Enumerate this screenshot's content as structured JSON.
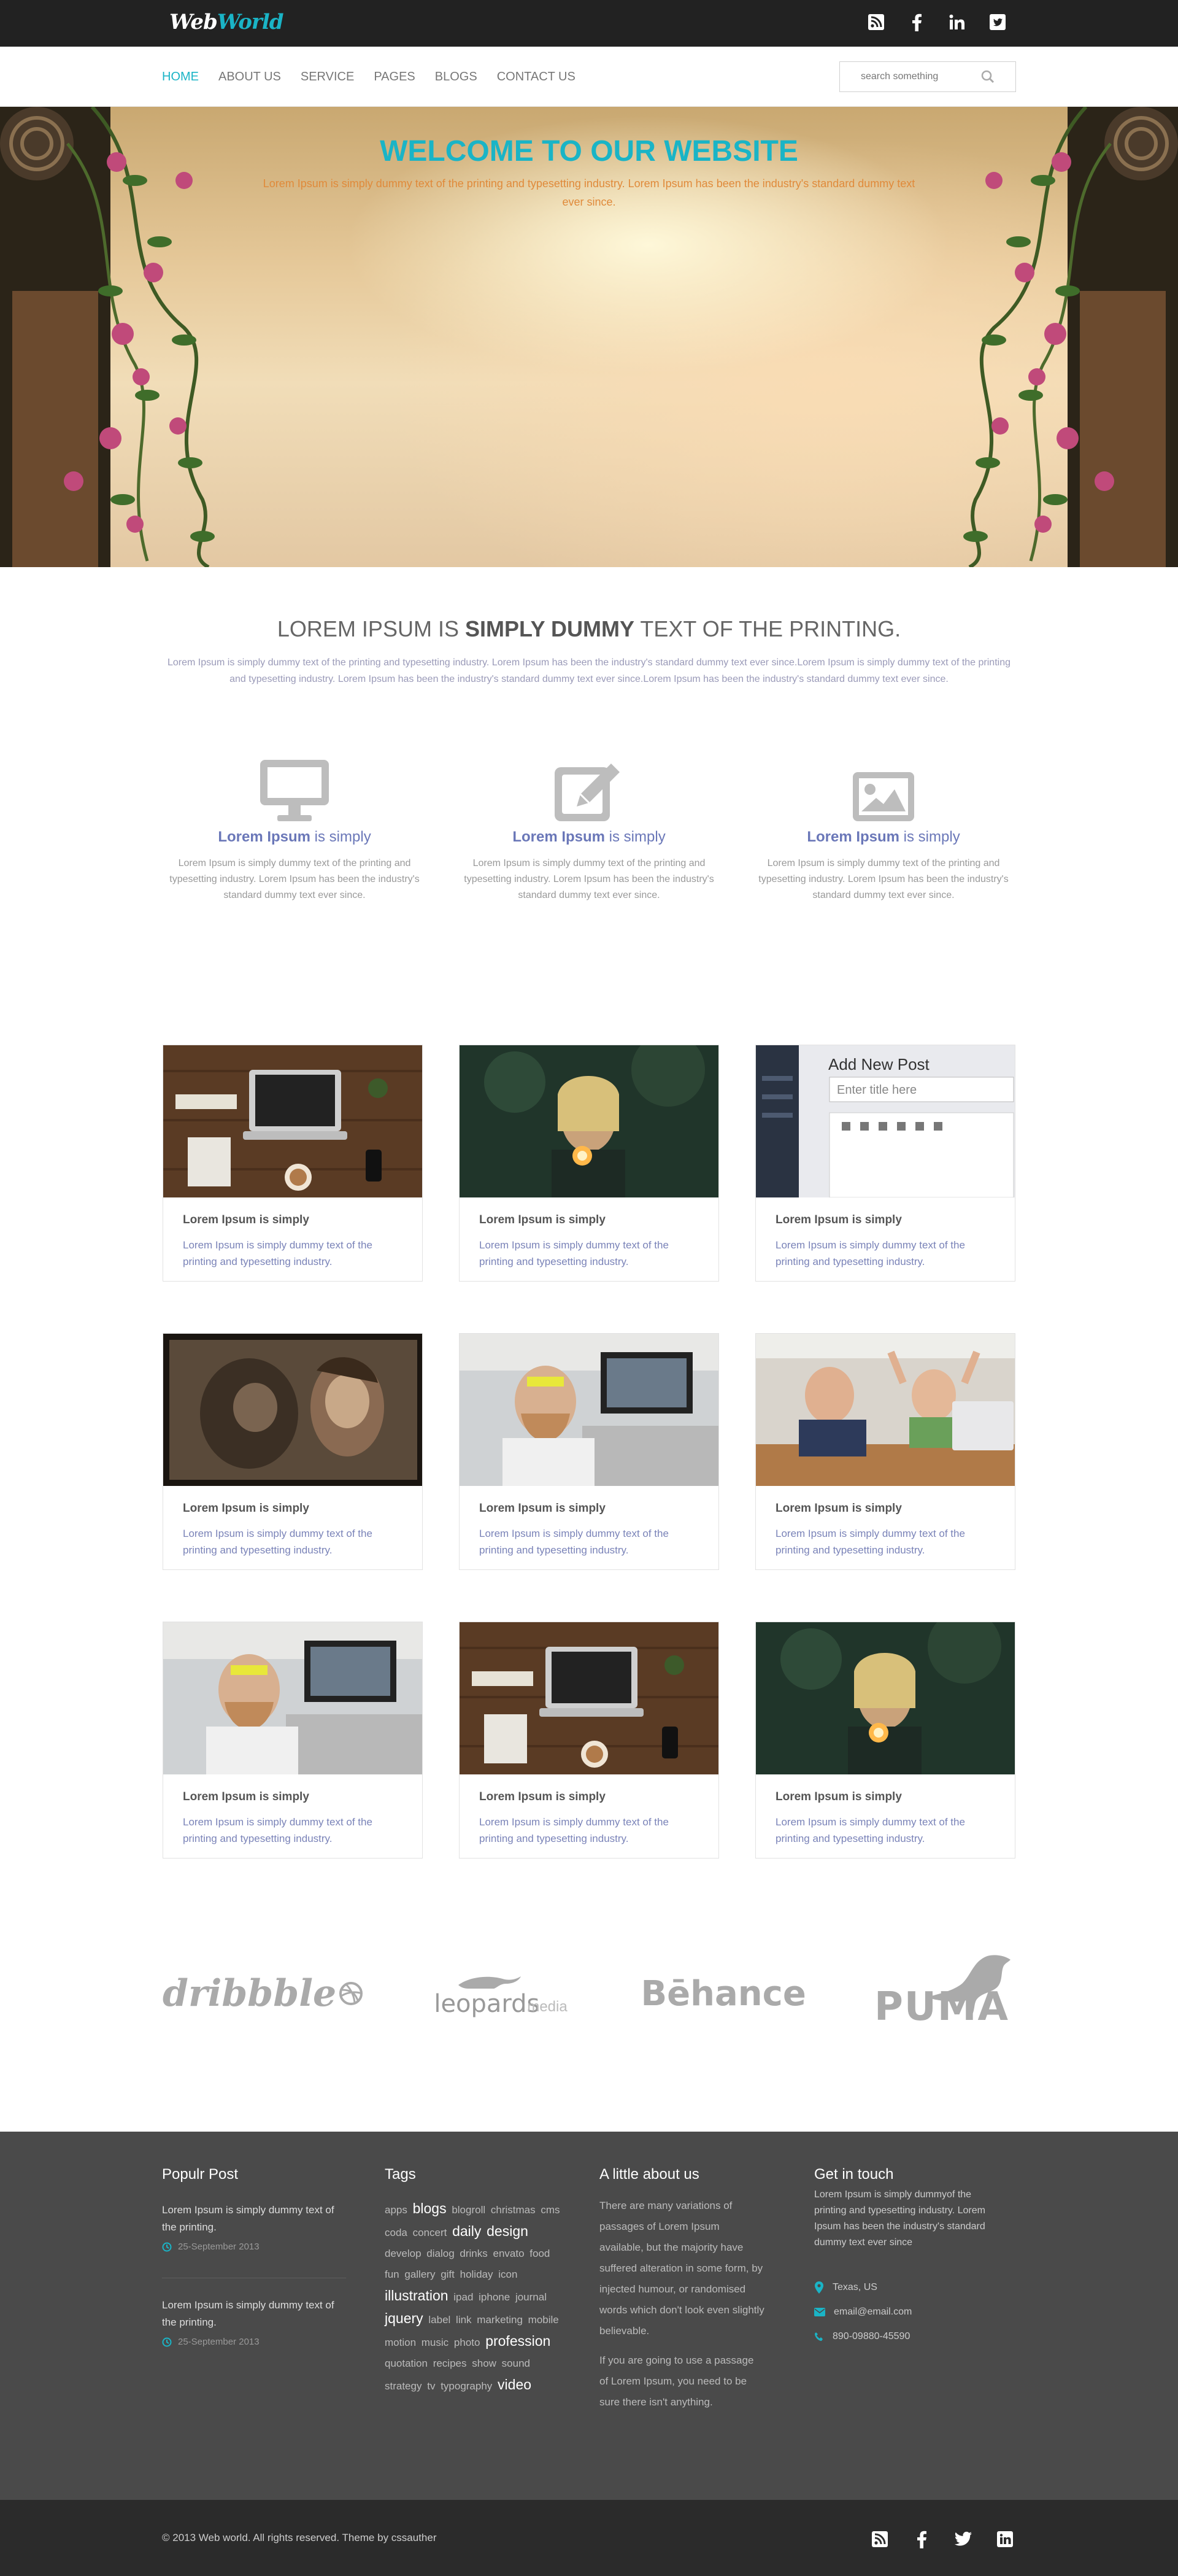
{
  "brand": {
    "part1": "Web",
    "part2": "World"
  },
  "social_top": [
    "rss-icon",
    "facebook-icon",
    "linkedin-icon",
    "twitter-icon"
  ],
  "nav": {
    "items": [
      "HOME",
      "ABOUT US",
      "SERVICE",
      "PAGES",
      "BLOGS",
      "CONTACT US"
    ],
    "active": "HOME",
    "search_placeholder": "search something"
  },
  "hero": {
    "title": "WELCOME TO OUR WEBSITE",
    "text": "Lorem Ipsum is simply dummy text of the printing and typesetting industry. Lorem Ipsum has been the industry's standard dummy text ever since."
  },
  "intro": {
    "title_a": "LOREM IPSUM IS ",
    "title_b": "SIMPLY DUMMY",
    "title_c": " TEXT OF THE PRINTING.",
    "text": "Lorem Ipsum is simply dummy text of the printing and typesetting industry. Lorem Ipsum has been the industry's standard dummy text ever since.Lorem Ipsum is simply dummy text of the printing and typesetting industry. Lorem Ipsum has been the industry's standard dummy text ever since.Lorem Ipsum has been the industry's standard dummy text ever since."
  },
  "features": [
    {
      "icon": "monitor-icon",
      "bold": "Lorem Ipsum",
      "rest": " is simply",
      "text": "Lorem Ipsum is simply dummy text of the printing and typesetting industry. Lorem Ipsum has been the industry's standard dummy text ever since."
    },
    {
      "icon": "edit-icon",
      "bold": "Lorem Ipsum",
      "rest": " is simply",
      "text": "Lorem Ipsum is simply dummy text of the printing and typesetting industry. Lorem Ipsum has been the industry's standard dummy text ever since."
    },
    {
      "icon": "image-icon",
      "bold": "Lorem Ipsum",
      "rest": " is simply",
      "text": "Lorem Ipsum is simply dummy text of the printing and typesetting industry. Lorem Ipsum has been the industry's standard dummy text ever since."
    }
  ],
  "cards": [
    {
      "title": "Lorem Ipsum is simply",
      "text": "Lorem Ipsum is simply dummy text of the printing and typesetting industry.",
      "photo": "desk"
    },
    {
      "title": "Lorem Ipsum is simply",
      "text": "Lorem Ipsum is simply dummy text of the printing and typesetting industry.",
      "photo": "sparkler"
    },
    {
      "title": "Lorem Ipsum is simply",
      "text": "Lorem Ipsum is simply dummy text of the printing and typesetting industry.",
      "photo": "editor",
      "overlay_title": "Add New Post",
      "overlay_field": "Enter title here"
    },
    {
      "title": "Lorem Ipsum is simply",
      "text": "Lorem Ipsum is simply dummy text of the printing and typesetting industry.",
      "photo": "monkey"
    },
    {
      "title": "Lorem Ipsum is simply",
      "text": "Lorem Ipsum is simply dummy text of the printing and typesetting industry.",
      "photo": "office"
    },
    {
      "title": "Lorem Ipsum is simply",
      "text": "Lorem Ipsum is simply dummy text of the printing and typesetting industry.",
      "photo": "kids"
    },
    {
      "title": "Lorem Ipsum is simply",
      "text": "Lorem Ipsum is simply dummy text of the printing and typesetting industry.",
      "photo": "office"
    },
    {
      "title": "Lorem Ipsum is simply",
      "text": "Lorem Ipsum is simply dummy text of the printing and typesetting industry.",
      "photo": "desk"
    },
    {
      "title": "Lorem Ipsum is simply",
      "text": "Lorem Ipsum is simply dummy text of the printing and typesetting industry.",
      "photo": "sparkler"
    }
  ],
  "brands": [
    "dribbble",
    "leopards",
    "media",
    "Bēhance",
    "PUMA"
  ],
  "footer": {
    "popular": {
      "title": "Populr Post",
      "posts": [
        {
          "text": "Lorem Ipsum is simply dummy text of the printing.",
          "date": "25-September 2013"
        },
        {
          "text": "Lorem Ipsum is simply dummy text of the printing.",
          "date": "25-September 2013"
        }
      ]
    },
    "tags": {
      "title": "Tags",
      "items": [
        {
          "t": "apps",
          "big": false
        },
        {
          "t": "blogs",
          "big": true
        },
        {
          "t": "blogroll",
          "big": false
        },
        {
          "t": "christmas",
          "big": false
        },
        {
          "t": "cms",
          "big": false
        },
        {
          "t": "coda",
          "big": false
        },
        {
          "t": "concert",
          "big": false
        },
        {
          "t": "daily",
          "big": true
        },
        {
          "t": "design",
          "big": true
        },
        {
          "t": "develop",
          "big": false
        },
        {
          "t": "dialog",
          "big": false
        },
        {
          "t": "drinks",
          "big": false
        },
        {
          "t": "envato",
          "big": false
        },
        {
          "t": "food",
          "big": false
        },
        {
          "t": "fun",
          "big": false
        },
        {
          "t": "gallery",
          "big": false
        },
        {
          "t": "gift",
          "big": false
        },
        {
          "t": "holiday",
          "big": false
        },
        {
          "t": "icon",
          "big": false
        },
        {
          "t": "illustration",
          "big": true
        },
        {
          "t": "ipad",
          "big": false
        },
        {
          "t": "iphone",
          "big": false
        },
        {
          "t": "journal",
          "big": false
        },
        {
          "t": "jquery",
          "big": true
        },
        {
          "t": "label",
          "big": false
        },
        {
          "t": "link",
          "big": false
        },
        {
          "t": "marketing",
          "big": false
        },
        {
          "t": "mobile",
          "big": false
        },
        {
          "t": "motion",
          "big": false
        },
        {
          "t": "music",
          "big": false
        },
        {
          "t": "photo",
          "big": false
        },
        {
          "t": "profession",
          "big": true
        },
        {
          "t": "quotation",
          "big": false
        },
        {
          "t": "recipes",
          "big": false
        },
        {
          "t": "show",
          "big": false
        },
        {
          "t": "sound",
          "big": false
        },
        {
          "t": "strategy",
          "big": false
        },
        {
          "t": "tv",
          "big": false
        },
        {
          "t": "typography",
          "big": false
        },
        {
          "t": "video",
          "big": true
        }
      ]
    },
    "about": {
      "title": "A little about us",
      "p1": "There are many variations of passages of Lorem Ipsum available, but the majority have suffered alteration in some form, by injected humour, or randomised words which don't look even slightly believable.",
      "p2": "If you are going to use a passage of Lorem Ipsum, you need to be sure there isn't anything."
    },
    "contact": {
      "title": "Get in touch",
      "text": "Lorem Ipsum is simply dummyof the printing and typesetting industry. Lorem Ipsum has been the industry's standard dummy text ever since",
      "location": "Texas, US",
      "email": "email@email.com",
      "phone": "890-09880-45590"
    }
  },
  "bottom": {
    "copyright": "© 2013 Web world. All rights reserved. Theme by cssauther",
    "social": [
      "rss-icon",
      "facebook-icon",
      "twitter-icon",
      "linkedin-icon"
    ]
  },
  "colors": {
    "accent": "#1ab4c6",
    "topbar": "#222222",
    "footer": "#4a4a4a",
    "bottombar": "#2b2b2b"
  }
}
